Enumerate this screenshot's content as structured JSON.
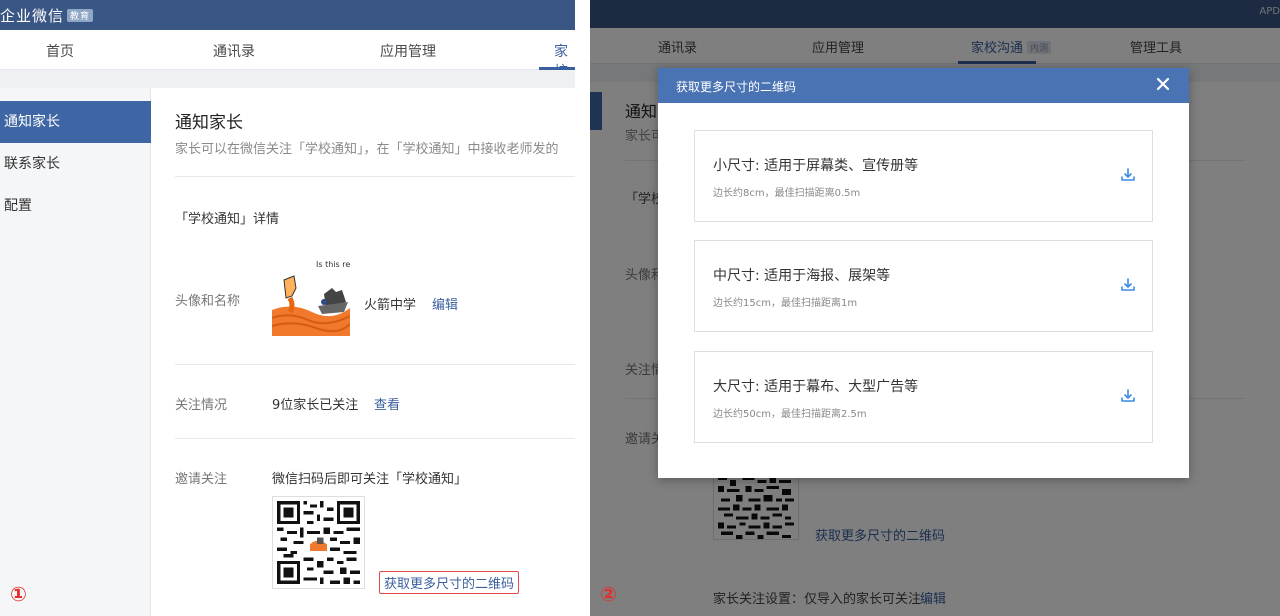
{
  "left": {
    "brand": "企业微信",
    "brand_badge": "教育",
    "nav": [
      "首页",
      "通讯录",
      "应用管理",
      "家校"
    ],
    "sidebar": [
      "通知家长",
      "联系家长",
      "配置"
    ],
    "page_title": "通知家长",
    "page_desc": "家长可以在微信关注「学校通知」，在「学校通知」中接收老师发的",
    "section_title": "「学校通知」详情",
    "avatar_label": "头像和名称",
    "avatar_caption": "Is this real life or is this just Fanta Sea?",
    "school_name": "火箭中学",
    "edit_label": "编辑",
    "follow_label": "关注情况",
    "follow_count": "9位家长已关注",
    "view_label": "查看",
    "invite_label": "邀请关注",
    "invite_text": "微信扫码后即可关注「学校通知」",
    "more_qr_label": "获取更多尺寸的二维码",
    "marker": "①"
  },
  "right": {
    "topright": "APD",
    "nav": [
      {
        "label": "通讯录"
      },
      {
        "label": "应用管理"
      },
      {
        "label": "家校沟通",
        "badge": "内测"
      },
      {
        "label": "管理工具"
      }
    ],
    "bg": {
      "title": "通知",
      "desc": "家长可",
      "section": "「学校",
      "avatar_label": "头像和",
      "follow_label": "关注情",
      "invite_label": "邀请关",
      "more_qr_label": "获取更多尺寸的二维码",
      "setting_label": "家长关注设置：仅导入的家长可关注",
      "edit_label": "编辑"
    },
    "modal": {
      "title": "获取更多尺寸的二维码",
      "sizes": [
        {
          "title": "小尺寸: 适用于屏幕类、宣传册等",
          "sub": "边长约8cm，最佳扫描距离0.5m"
        },
        {
          "title": "中尺寸: 适用于海报、展架等",
          "sub": "边长约15cm，最佳扫描距离1m"
        },
        {
          "title": "大尺寸: 适用于幕布、大型广告等",
          "sub": "边长约50cm，最佳扫描距离2.5m"
        }
      ]
    },
    "marker": "②"
  },
  "colors": {
    "topbar": "#3a5684",
    "accent": "#3f66a4",
    "modal_header": "#4a73b3",
    "link": "#3a5f9f",
    "download_icon": "#3b8be0",
    "marker": "#e03030"
  }
}
